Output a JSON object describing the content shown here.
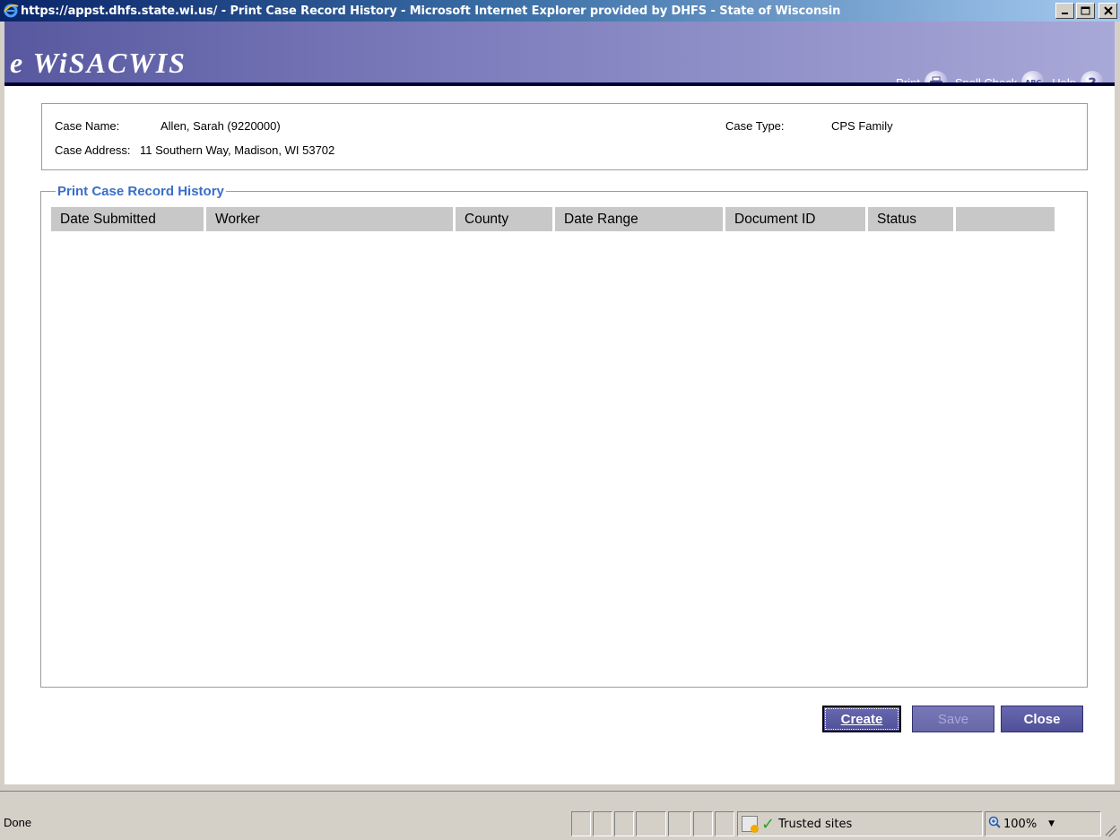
{
  "window": {
    "title": "https://appst.dhfs.state.wi.us/ - Print Case Record History - Microsoft Internet Explorer provided by DHFS - State of Wisconsin",
    "minimize": "_",
    "maximize": "□",
    "close": "✕"
  },
  "header": {
    "logo": "e WiSACWIS",
    "print_label": "Print",
    "spellcheck_label": "Spell Check",
    "help_label": "Help",
    "help_icon": "?",
    "spellcheck_icon": "ABC"
  },
  "case": {
    "name_label": "Case Name:",
    "name_value": "Allen, Sarah (9220000)",
    "address_label": "Case Address:",
    "address_value": "11 Southern Way, Madison, WI 53702",
    "type_label": "Case Type:",
    "type_value": "CPS Family"
  },
  "history": {
    "legend": "Print Case Record History",
    "columns": [
      "Date Submitted",
      "Worker",
      "County",
      "Date Range",
      "Document ID",
      "Status",
      ""
    ]
  },
  "buttons": {
    "create": "Create",
    "save": "Save",
    "close": "Close"
  },
  "statusbar": {
    "status": "Done",
    "zone": "Trusted sites",
    "zoom": "100%"
  },
  "colors": {
    "header_accent": "#7c7cbc",
    "legend_text": "#3a6ec8",
    "button_bg": "#505098"
  }
}
